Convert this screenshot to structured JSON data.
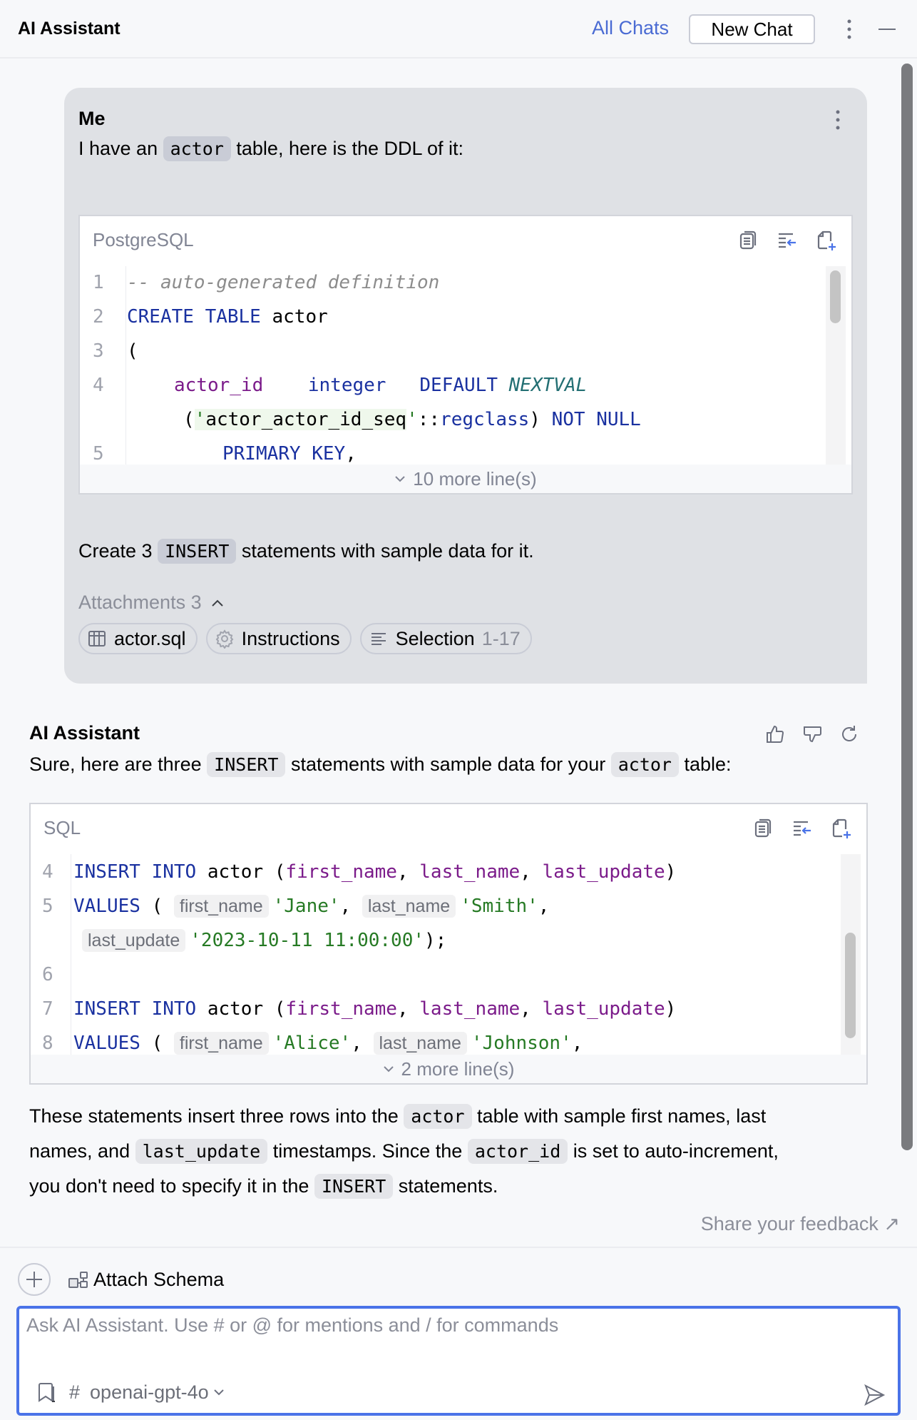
{
  "header": {
    "title": "AI Assistant",
    "all_chats_label": "All Chats",
    "new_chat_label": "New Chat"
  },
  "user_message": {
    "author": "Me",
    "intro_before": "I have an",
    "intro_code": "actor",
    "intro_after": "table, here is the DDL of it:",
    "code_block": {
      "language": "PostgreSQL",
      "gutter_numbers": [
        "1",
        "2",
        "3",
        "4",
        "5"
      ],
      "lines": {
        "l1": "-- auto-generated definition",
        "l2_kw": "CREATE TABLE",
        "l2_name": " actor",
        "l3": "(",
        "l4_col": "actor_id",
        "l4_type": "integer",
        "l4_default": "DEFAULT",
        "l4_fn": "NEXTVAL",
        "l4b_open": "(",
        "l4b_q1": "'",
        "l4b_str": "actor_actor_id_seq",
        "l4b_q2": "'",
        "l4b_cast": "::",
        "l4b_type": "regclass",
        "l4b_close": ")",
        "l4b_kw": "NOT NULL",
        "l5_kw": "PRIMARY KEY",
        "l5_tail": ","
      },
      "more_lines": "10 more line(s)"
    },
    "request_before": "Create 3",
    "request_code": "INSERT",
    "request_after": "statements with sample data for it.",
    "attachments_label": "Attachments 3",
    "attachments": [
      {
        "icon": "table-icon",
        "label": "actor.sql",
        "suffix": ""
      },
      {
        "icon": "gear-icon",
        "label": "Instructions",
        "suffix": ""
      },
      {
        "icon": "text-lines-icon",
        "label": "Selection",
        "suffix": "1-17"
      }
    ]
  },
  "assistant_message": {
    "author": "AI Assistant",
    "intro_a": "Sure, here are three",
    "intro_code1": "INSERT",
    "intro_b": "statements with sample data for your",
    "intro_code2": "actor",
    "intro_c": "table:",
    "code_block": {
      "language": "SQL",
      "gutter_numbers": [
        "4",
        "5",
        "6",
        "7",
        "8"
      ],
      "lines": {
        "insert_kw": "INSERT INTO",
        "table": " actor ",
        "open": "(",
        "c1": "first_name",
        "c2": "last_name",
        "c3": "last_update",
        "close": ")",
        "sep": ", ",
        "values_kw": "VALUES",
        "values_open": " ( ",
        "hint_first": "first_name",
        "hint_last": "last_name",
        "hint_update": "last_update",
        "v1_first": "'Jane'",
        "v1_last": "'Smith'",
        "v1_update": "'2023-10-11 11:00:00'",
        "v1_end": ");",
        "v2_first": "'Alice'",
        "v2_last": "'Johnson'",
        "comma": ","
      },
      "more_lines": "2 more line(s)"
    },
    "para": {
      "p1": "These statements insert three rows into the",
      "c1": "actor",
      "p2": "table with sample first names, last",
      "p3": "names, and",
      "c2": "last_update",
      "p4": "timestamps. Since the",
      "c3": "actor_id",
      "p5": "is set to auto-increment,",
      "p6": "you don't need to specify it in the",
      "c4": "INSERT",
      "p7": "statements."
    },
    "feedback_label": "Share your feedback ↗"
  },
  "composer": {
    "attach_schema_label": "Attach Schema",
    "input_value": "",
    "input_placeholder": "Ask AI Assistant. Use # or @ for mentions and / for commands",
    "hash_label": "#",
    "model": "openai-gpt-4o"
  },
  "colors": {
    "accent": "#4a73e8",
    "link": "#4a6bd3",
    "keyword": "#1a31a0",
    "column": "#7b1b8a",
    "string": "#267a24"
  }
}
